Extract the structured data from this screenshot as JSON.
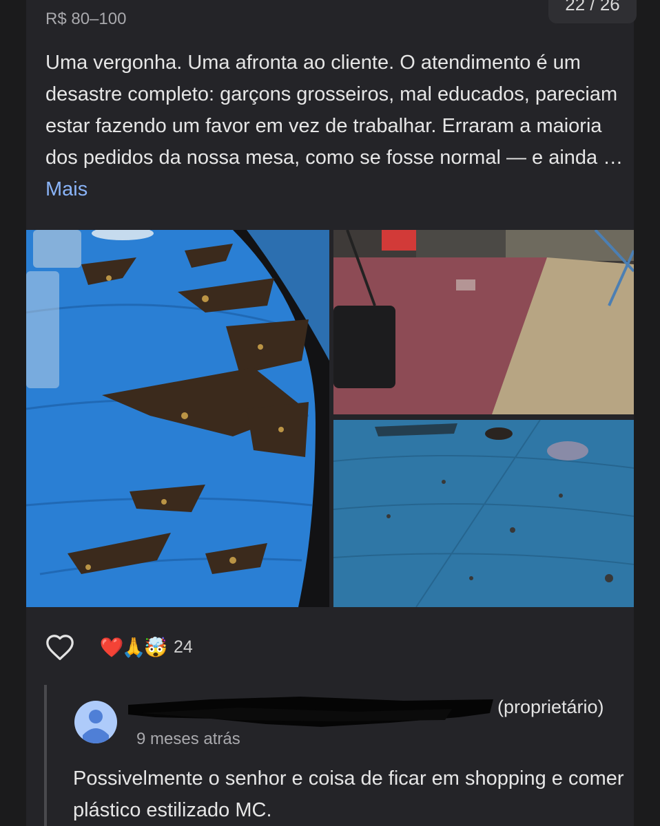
{
  "review": {
    "price_range": "R$ 80–100",
    "photo_counter": "22 / 26",
    "text": "Uma vergonha. Uma afronta ao cliente. O atendimento é um desastre completo: garçons grosseiros, mal educados, pareciam estar fazendo um favor em vez de trabalhar. Erraram a maioria dos pedidos da nossa mesa, como se fosse normal — e ainda … ",
    "more_label": "Mais",
    "like_icon": "heart-outline-icon",
    "reactions": {
      "emojis": [
        "❤️",
        "🙏",
        "🤯"
      ],
      "count": "24"
    }
  },
  "owner_reply": {
    "name_suffix": "(proprietário)",
    "time": "9 meses atrás",
    "text": "Possivelmente o senhor e coisa de ficar em shopping e comer plástico estilizado MC.",
    "avatar_color": "#aecbfa"
  }
}
